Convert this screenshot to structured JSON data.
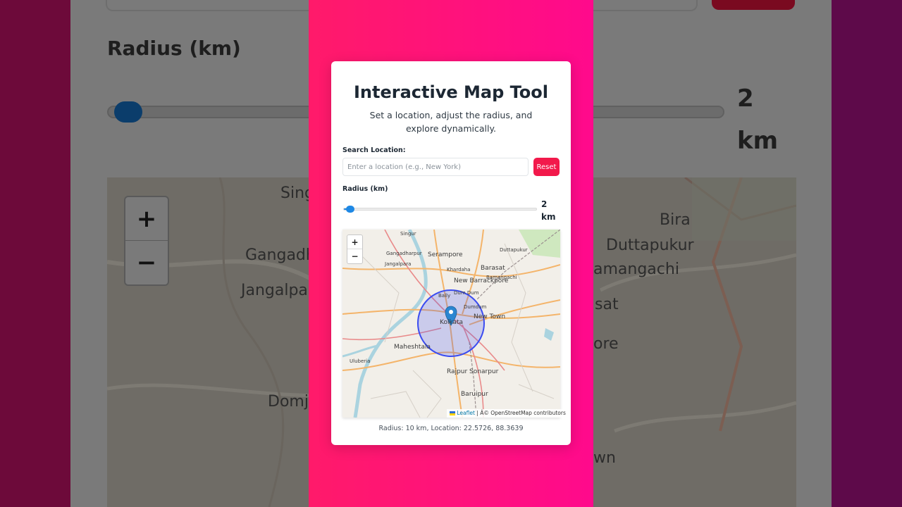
{
  "app": {
    "title": "Interactive Map Tool",
    "subtitle": "Set a location, adjust the radius, and explore dynamically."
  },
  "search": {
    "label": "Search Location:",
    "value": "",
    "placeholder": "Enter a location (e.g., New York)",
    "reset_label": "Reset"
  },
  "radius": {
    "label": "Radius (km)",
    "min": 1,
    "max": 100,
    "value": 2,
    "value_number": "2",
    "unit": "km"
  },
  "map": {
    "center": {
      "lat": 22.5726,
      "lng": 88.3639
    },
    "circle_radius_km": 10,
    "zoom_in_label": "+",
    "zoom_out_label": "−",
    "places": {
      "singur": "Singur",
      "gangadharpur": "Gangadharpur",
      "serampore": "Serampore",
      "dattapukur": "Duttapukur",
      "jangalpara": "Jangalpara",
      "khardaha": "Khardaha",
      "barasat": "Barasat",
      "bamangachi": "Bamangachi",
      "new_barrackpore": "New Barrackpore",
      "dum_dum": "Dum Dum",
      "bally": "Bally",
      "dumdum_mini": "Dumdum",
      "kolkata": "Kolkata",
      "new_town": "New Town",
      "maheshtala": "Maheshtala",
      "uluberia": "Uluberia",
      "rajpur_sonarpur": "Rajpur Sonarpur",
      "baruipur": "Baruipur"
    },
    "attribution_leaflet": "Leaflet",
    "attribution_rest": " | Â© OpenStreetMap contributors"
  },
  "status_text": "Radius: 10 km, Location: 22.5726, 88.3639",
  "backdrop": {
    "radius_label": "Radius (km)",
    "value_number": "2",
    "unit": "km",
    "zoom_in": "+",
    "zoom_out": "−",
    "places": {
      "singur": "Sing",
      "gangadharpur": "Gangadh",
      "jangalpara": "Jangalpar",
      "domjur": "Domju",
      "bira": "Bira",
      "duttapukur": "Duttapukur",
      "bamangachi": "amangachi",
      "barasat_frag": "sat",
      "barrackpore_frag": "ore",
      "town_frag": "wn"
    }
  },
  "colors": {
    "accent_pink": "#ff0a8c",
    "reset_red": "#f2194b",
    "slider_blue": "#1e88e5",
    "circle_stroke": "#3b4cf0",
    "marker_blue": "#2a86d1"
  },
  "icons": {
    "marker": "map-pin-icon",
    "flag": "ukraine-flag-icon"
  }
}
